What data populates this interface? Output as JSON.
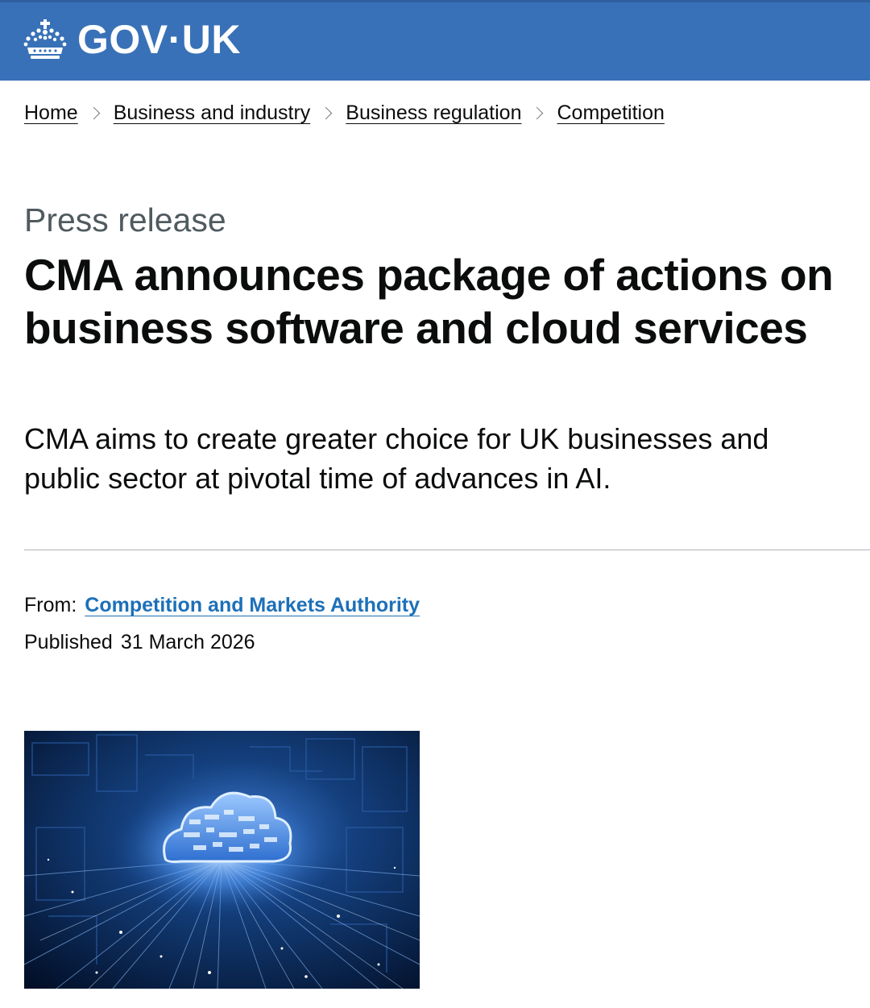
{
  "header": {
    "logo_text": "GOV·UK",
    "icon": "crown-icon",
    "background_color": "#3871b7"
  },
  "breadcrumbs": [
    {
      "label": "Home"
    },
    {
      "label": "Business and industry"
    },
    {
      "label": "Business regulation"
    },
    {
      "label": "Competition"
    }
  ],
  "article": {
    "caption": "Press release",
    "title": "CMA announces package of actions on business software and cloud services",
    "lede": "CMA aims to create greater choice for UK businesses and public sector at pivotal time of advances in AI."
  },
  "meta": {
    "from_label": "From:",
    "from_org": "Competition and Markets Authority",
    "published_label": "Published",
    "published_date": "31 March 2026"
  },
  "image": {
    "subject": "cloud-computing-illustration"
  },
  "colors": {
    "link": "#1d70b8",
    "text": "#0b0c0c",
    "secondary_text": "#505a5f"
  }
}
